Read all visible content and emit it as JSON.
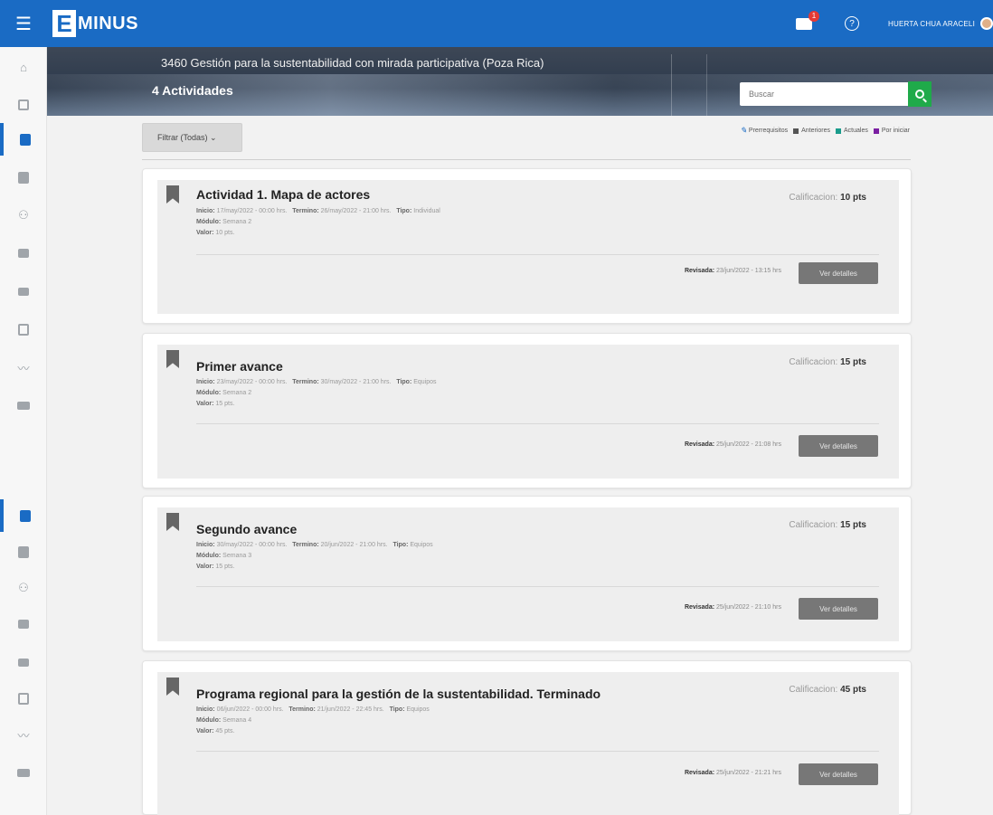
{
  "app": {
    "logo_letter": "E",
    "logo_text": "MINUS",
    "menu_icon": "hamburger-icon"
  },
  "header": {
    "mail_badge": "1",
    "user_name": "HUERTA CHUA ARACELI"
  },
  "banner": {
    "course_title": "3460 Gestión para la sustentabilidad con mirada participativa (Poza Rica)",
    "activity_count": "4 Actividades",
    "search_placeholder": "Buscar"
  },
  "filter": {
    "label": "Filtrar (Todas) ⌄"
  },
  "legend": {
    "prereq": "Prerrequisitos",
    "items": [
      {
        "label": "Anteriores",
        "color": "#555555"
      },
      {
        "label": "Actuales",
        "color": "#1a9c8c"
      },
      {
        "label": "Por iniciar",
        "color": "#7b1fa2"
      }
    ]
  },
  "labels": {
    "inicio": "Inicio:",
    "termino": "Termino:",
    "tipo": "Tipo:",
    "modulo": "Módulo:",
    "valor": "Valor:",
    "calificacion": "Calificacion:",
    "revisada": "Revisada:",
    "details_button": "Ver detalles"
  },
  "activities": [
    {
      "title": "Actividad 1. Mapa de actores",
      "inicio": "17/may/2022 - 00:00 hrs.",
      "termino": "26/may/2022 - 21:00 hrs.",
      "tipo": "Individual",
      "modulo": "Semana 2",
      "valor": "10 pts.",
      "grade": "10 pts",
      "revisada": "23/jun/2022 - 13:15 hrs"
    },
    {
      "title": "Primer avance",
      "inicio": "23/may/2022 - 00:00 hrs.",
      "termino": "30/may/2022 - 21:00 hrs.",
      "tipo": "Equipos",
      "modulo": "Semana 2",
      "valor": "15 pts.",
      "grade": "15 pts",
      "revisada": "25/jun/2022 - 21:08 hrs"
    },
    {
      "title": "Segundo avance",
      "inicio": "30/may/2022 - 00:00 hrs.",
      "termino": "20/jun/2022 - 21:00 hrs.",
      "tipo": "Equipos",
      "modulo": "Semana 3",
      "valor": "15 pts.",
      "grade": "15 pts",
      "revisada": "25/jun/2022 - 21:10 hrs"
    },
    {
      "title": "Programa regional para la gestión de la sustentabilidad. Terminado",
      "inicio": "06/jun/2022 - 00:00 hrs.",
      "termino": "21/jun/2022 - 22:45 hrs.",
      "tipo": "Equipos",
      "modulo": "Semana 4",
      "valor": "45 pts.",
      "grade": "45 pts",
      "revisada": "25/jun/2022 - 21:21 hrs"
    }
  ],
  "sidebar": {
    "icons": [
      "home-icon",
      "dashboard-icon",
      "activities-icon",
      "book-icon",
      "people-icon",
      "chat-icon",
      "mail-icon",
      "calendar-icon",
      "chart-icon",
      "panel-icon"
    ]
  }
}
